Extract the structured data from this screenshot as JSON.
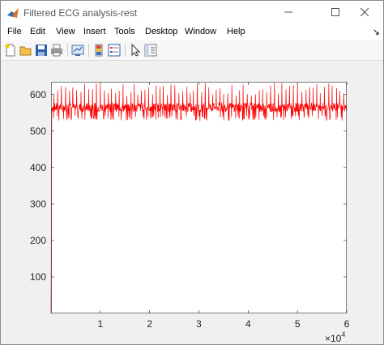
{
  "window": {
    "title": "Filtered ECG analysis-rest"
  },
  "menu": {
    "items": [
      "File",
      "Edit",
      "View",
      "Insert",
      "Tools",
      "Desktop",
      "Window",
      "Help"
    ],
    "overflow_arrow": "↘"
  },
  "toolbar": {
    "buttons": [
      "new-figure-icon",
      "open-file-icon",
      "save-icon",
      "print-icon",
      "link-plot-icon",
      "insert-colorbar-icon",
      "insert-legend-icon",
      "edit-plot-icon",
      "property-inspector-icon"
    ]
  },
  "colors": {
    "series": "#ff0000",
    "axes_bg": "#ffffff",
    "figure_bg": "#f0f0f0"
  },
  "chart_data": {
    "type": "line",
    "xlim": [
      0,
      60000
    ],
    "ylim": [
      0,
      635
    ],
    "x_ticks": [
      10000,
      20000,
      30000,
      40000,
      50000,
      60000
    ],
    "x_tick_labels": [
      "1",
      "2",
      "3",
      "4",
      "5",
      "6"
    ],
    "x_exponent": "×10",
    "x_exponent_power": "4",
    "y_ticks": [
      100,
      200,
      300,
      400,
      500,
      600
    ],
    "y_tick_labels": [
      "100",
      "200",
      "300",
      "400",
      "500",
      "600"
    ],
    "grid": false,
    "series": [
      {
        "color": "#ff0000",
        "initial_rise": {
          "x": [
            0,
            150
          ],
          "y": [
            0,
            560
          ]
        },
        "baseline_band": [
          540,
          590
        ],
        "peak_band": [
          595,
          632
        ],
        "approx_beat_interval": 780,
        "x_end": 60000
      }
    ]
  }
}
